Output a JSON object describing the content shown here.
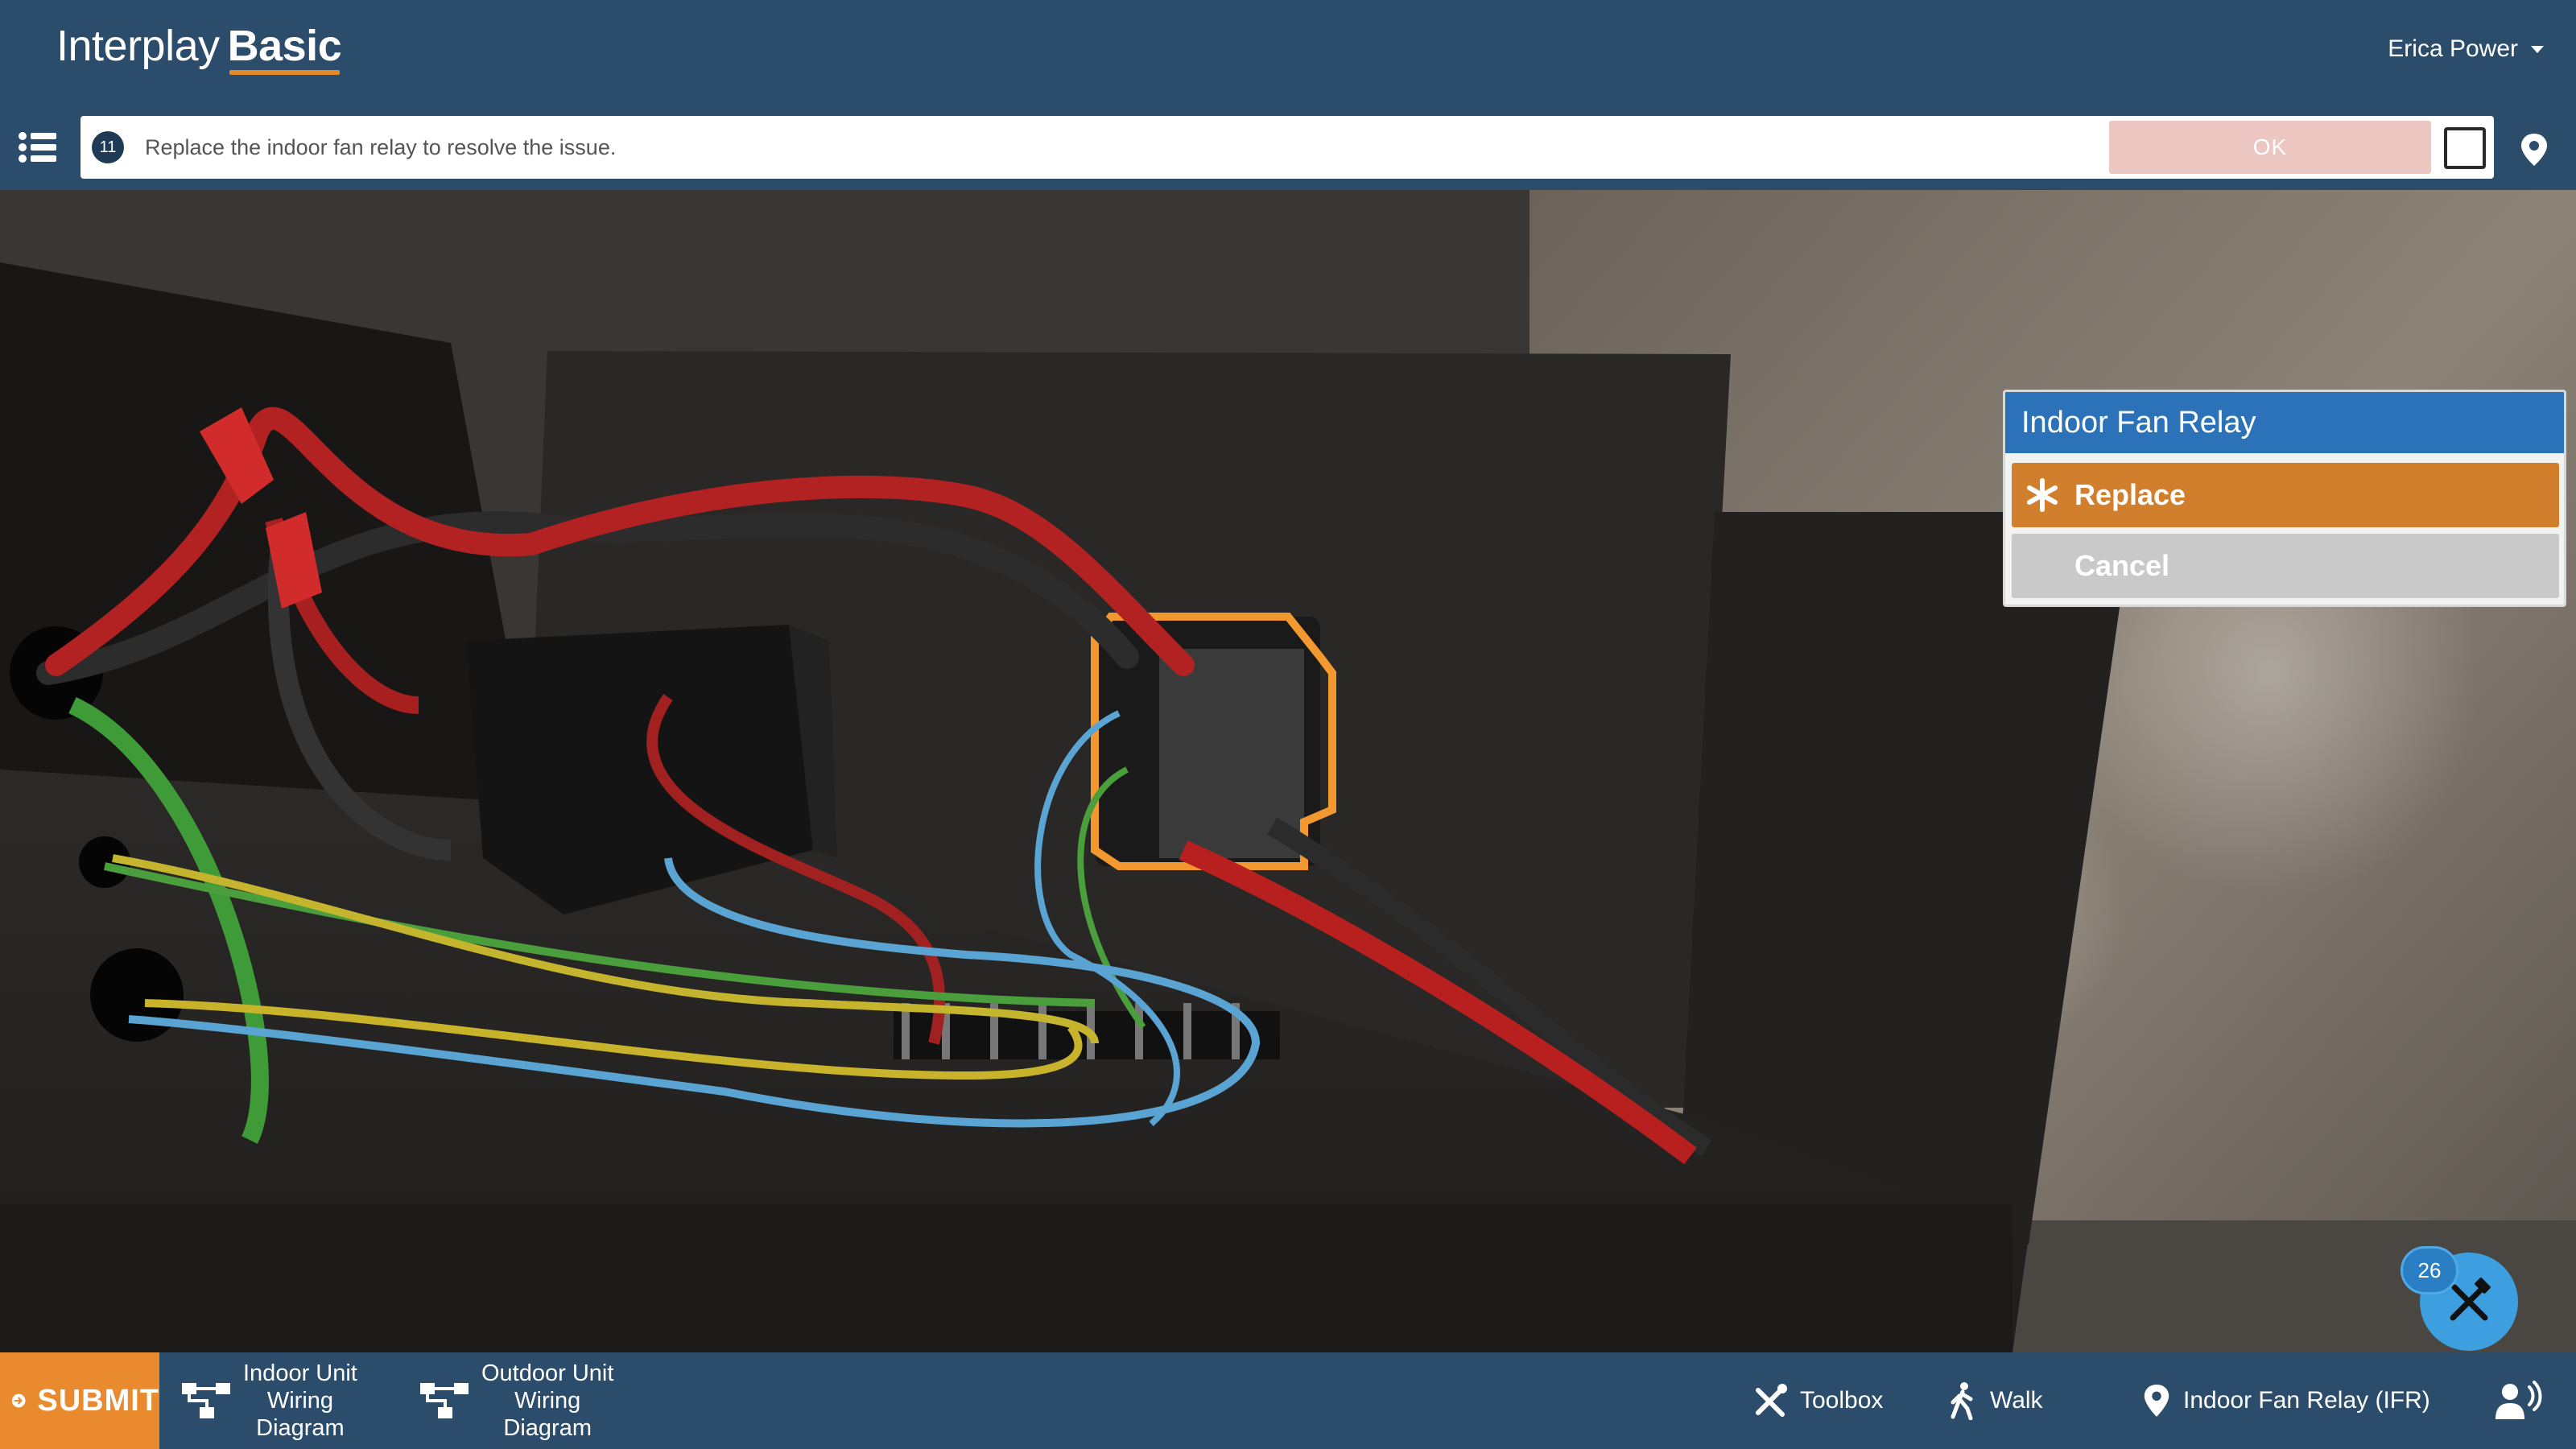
{
  "header": {
    "brand_light": "Interplay",
    "brand_bold": "Basic",
    "user_name": "Erica Power"
  },
  "instruction": {
    "step_number": "11",
    "text": "Replace the indoor fan relay to resolve the issue.",
    "ok_label": "OK"
  },
  "popup": {
    "title": "Indoor Fan Relay",
    "replace_label": "Replace",
    "cancel_label": "Cancel"
  },
  "tool_badge": {
    "count": "26"
  },
  "bottom_bar": {
    "submit_label": "SUBMIT",
    "indoor_diagram": [
      "Indoor Unit",
      "Wiring",
      "Diagram"
    ],
    "outdoor_diagram": [
      "Outdoor Unit",
      "Wiring",
      "Diagram"
    ],
    "toolbox_label": "Toolbox",
    "walk_label": "Walk",
    "location_label": "Indoor Fan Relay (IFR)"
  },
  "colors": {
    "header_bg": "#2c4c6c",
    "accent_orange": "#e88a2d",
    "popup_title_bg": "#2c72b8",
    "fab_blue": "#3d9fe0"
  },
  "icons": [
    "list-icon",
    "location-pin-icon",
    "asterisk-icon",
    "tools-icon",
    "submit-arrow-icon",
    "wiring-diagram-icon",
    "walk-icon",
    "voice-icon",
    "checkbox"
  ]
}
